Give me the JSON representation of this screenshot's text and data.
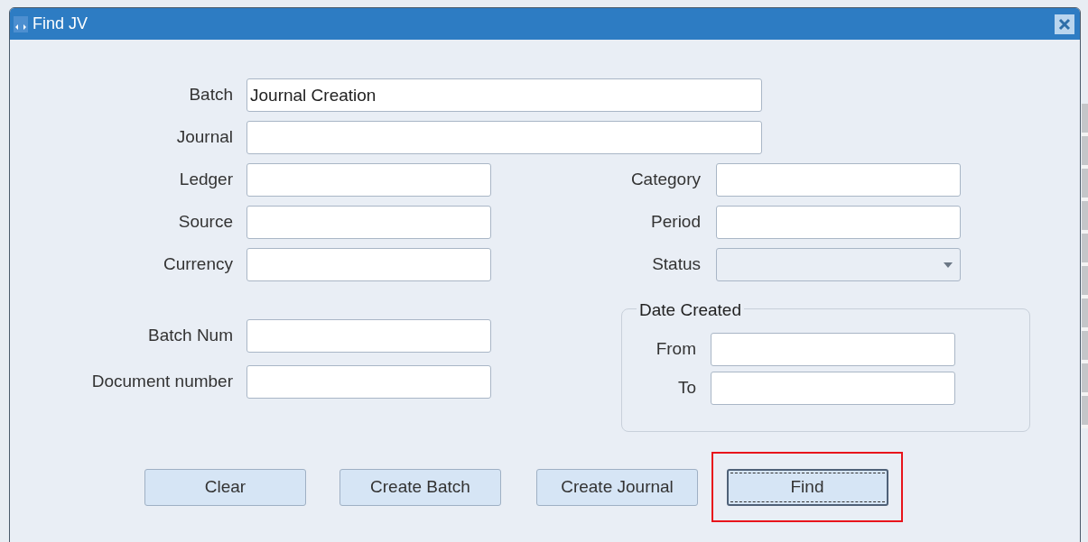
{
  "window": {
    "title": "Find JV"
  },
  "top_fields": [
    {
      "label": "Batch",
      "value": "Journal Creation"
    },
    {
      "label": "Journal"
    }
  ],
  "left_fields": [
    {
      "label": "Ledger",
      "kind": "text"
    },
    {
      "label": "Source",
      "kind": "text"
    },
    {
      "label": "Currency",
      "kind": "text"
    },
    {
      "label": "Batch Num",
      "kind": "text"
    },
    {
      "label": "Document number",
      "kind": "text"
    }
  ],
  "right_fields": [
    {
      "label": "Category",
      "kind": "text"
    },
    {
      "label": "Period",
      "kind": "text"
    },
    {
      "label": "Status",
      "kind": "select"
    }
  ],
  "date_created": {
    "title": "Date Created",
    "fields": [
      {
        "label": "From"
      },
      {
        "label": "To"
      }
    ]
  },
  "buttons": [
    {
      "label": "Clear",
      "focused": false,
      "highlighted": false
    },
    {
      "label": "Create Batch",
      "focused": false,
      "highlighted": false
    },
    {
      "label": "Create Journal",
      "focused": false,
      "highlighted": false
    },
    {
      "label": "Find",
      "focused": true,
      "highlighted": true
    }
  ]
}
